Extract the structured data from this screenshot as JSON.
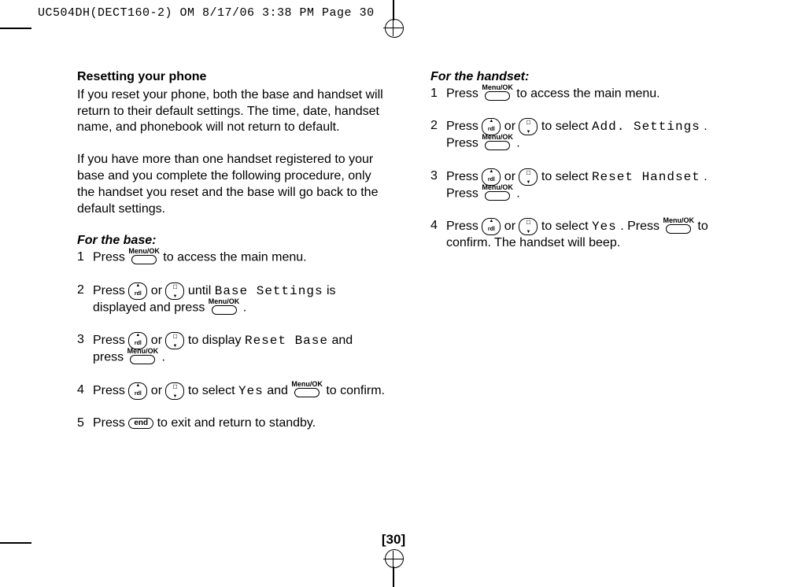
{
  "header": "UC504DH(DECT160-2) OM  8/17/06  3:38 PM  Page 30",
  "page_number": "[30]",
  "icons": {
    "menu_ok_label": "Menu/OK",
    "end_label": "end"
  },
  "left": {
    "title": "Resetting your phone",
    "intro1": "If you reset your phone, both the base and handset will return to their default settings. The time, date, handset name, and phonebook will not return to default.",
    "intro2": "If you have more than one handset registered to your base and you complete the following procedure, only the handset you reset and the base will go back to the default settings.",
    "base_heading": "For the base:",
    "s1a": "Press ",
    "s1b": " to access the main menu.",
    "s2a": "Press ",
    "s2b": " or ",
    "s2c": " until ",
    "s2d": "Base Settings",
    "s2e": " is displayed and press ",
    "s2f": " .",
    "s3a": "Press ",
    "s3b": " or ",
    "s3c": " to display ",
    "s3d": "Reset Base",
    "s3e": " and press ",
    "s3f": " .",
    "s4a": "Press ",
    "s4b": " or ",
    "s4c": " to select ",
    "s4d": "Yes",
    "s4e": " and ",
    "s4f": " to confirm.",
    "s5a": "Press ",
    "s5b": " to exit and return to standby."
  },
  "right": {
    "handset_heading": "For the handset:",
    "s1a": "Press ",
    "s1b": " to access the main menu.",
    "s2a": "Press ",
    "s2b": " or ",
    "s2c": " to select ",
    "s2d": "Add. Settings",
    "s2e": ". Press ",
    "s2f": " .",
    "s3a": "Press ",
    "s3b": " or ",
    "s3c": " to select ",
    "s3d": "Reset Handset",
    "s3e": ". Press ",
    "s3f": " .",
    "s4a": "Press ",
    "s4b": " or ",
    "s4c": " to select ",
    "s4d": "Yes",
    "s4e": ". Press ",
    "s4f": " to confirm. The handset will beep."
  }
}
